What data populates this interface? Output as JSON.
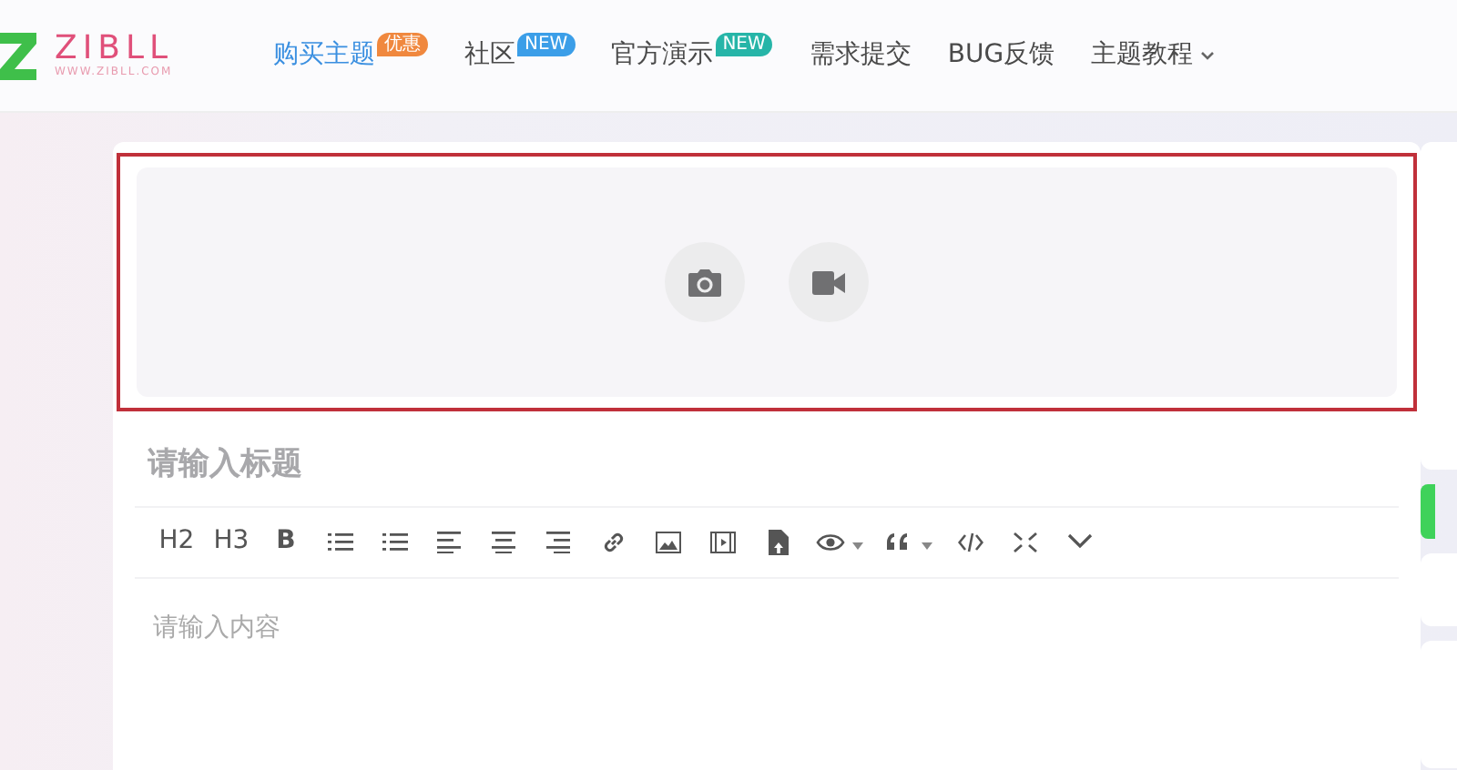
{
  "logo": {
    "name": "ZIBLL",
    "url": "WWW.ZIBLL.COM"
  },
  "nav": [
    {
      "label": "购买主题",
      "selected": true,
      "badge": {
        "text": "优惠",
        "color": "#f0883e"
      },
      "dropdown": false
    },
    {
      "label": "社区",
      "selected": false,
      "badge": {
        "text": "NEW",
        "color": "#3b9ee8"
      },
      "dropdown": false
    },
    {
      "label": "官方演示",
      "selected": false,
      "badge": {
        "text": "NEW",
        "color": "#26b5a8"
      },
      "dropdown": false
    },
    {
      "label": "需求提交",
      "selected": false,
      "dropdown": false
    },
    {
      "label": "BUG反馈",
      "selected": false,
      "dropdown": false
    },
    {
      "label": "主题教程",
      "selected": false,
      "dropdown": true
    }
  ],
  "editor": {
    "title_placeholder": "请输入标题",
    "content_placeholder": "请输入内容",
    "toolbar_text": [
      "H2",
      "H3",
      "B"
    ]
  }
}
